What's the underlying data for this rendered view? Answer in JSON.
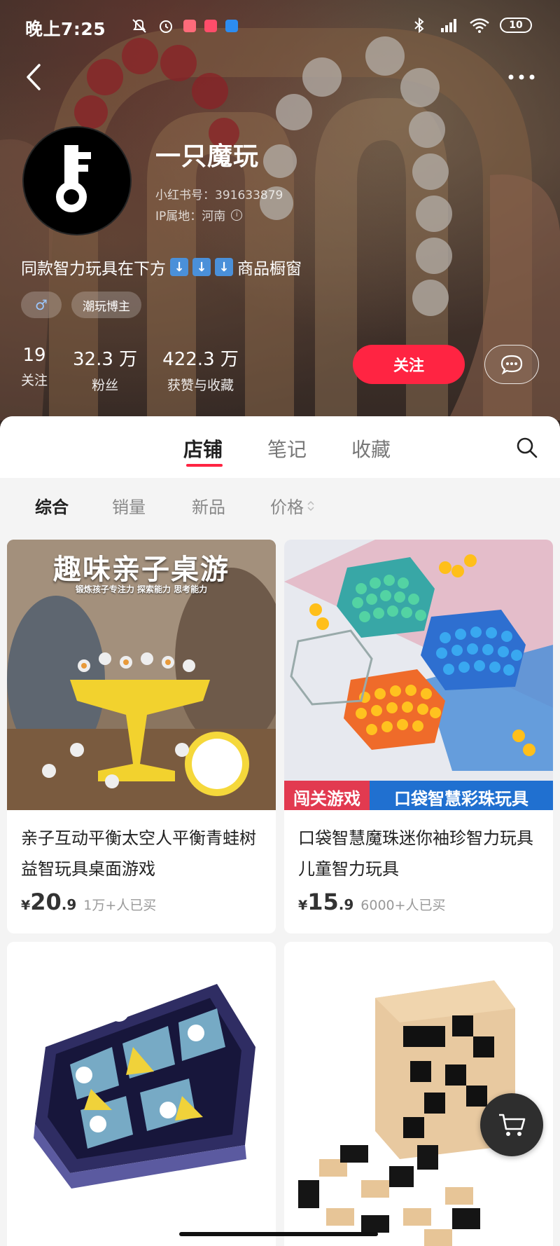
{
  "status_bar": {
    "time": "晚上7:25",
    "battery": "10"
  },
  "profile": {
    "name": "一只魔玩",
    "xhs_id": "小红书号：391633879",
    "ip_location": "IP属地：河南",
    "bio_prefix": "同款智力玩具在下方",
    "bio_suffix": "商品橱窗",
    "tag_gender": "♂",
    "tag_role": "潮玩博主"
  },
  "stats": [
    {
      "value": "19",
      "label": "关注"
    },
    {
      "value": "32.3 万",
      "label": "粉丝"
    },
    {
      "value": "422.3 万",
      "label": "获赞与收藏"
    }
  ],
  "actions": {
    "follow_label": "关注"
  },
  "tabs": [
    {
      "label": "店铺",
      "active": true
    },
    {
      "label": "笔记",
      "active": false
    },
    {
      "label": "收藏",
      "active": false
    }
  ],
  "filters": [
    {
      "label": "综合",
      "active": true
    },
    {
      "label": "销量",
      "active": false
    },
    {
      "label": "新品",
      "active": false
    },
    {
      "label": "价格",
      "active": false
    }
  ],
  "products": [
    {
      "image_caption": "趣味亲子桌游",
      "image_subcaption": "锻炼孩子专注力 探索能力 思考能力",
      "title": "亲子互动平衡太空人平衡青蛙树益智玩具桌面游戏",
      "price_yen": "¥",
      "price_int": "20",
      "price_dec": ".9",
      "sold": "1万+人已买"
    },
    {
      "image_caption_left": "闯关游戏",
      "image_caption_right": "口袋智慧彩珠玩具",
      "title": "口袋智慧魔珠迷你袖珍智力玩具儿童智力玩具",
      "price_yen": "¥",
      "price_int": "15",
      "price_dec": ".9",
      "sold": "6000+人已买"
    },
    {
      "title": "",
      "sold": ""
    },
    {
      "title": "",
      "sold": ""
    }
  ],
  "colors": {
    "accent": "#ff2442",
    "tab_active": "#222222",
    "tab_inactive": "#777777"
  }
}
